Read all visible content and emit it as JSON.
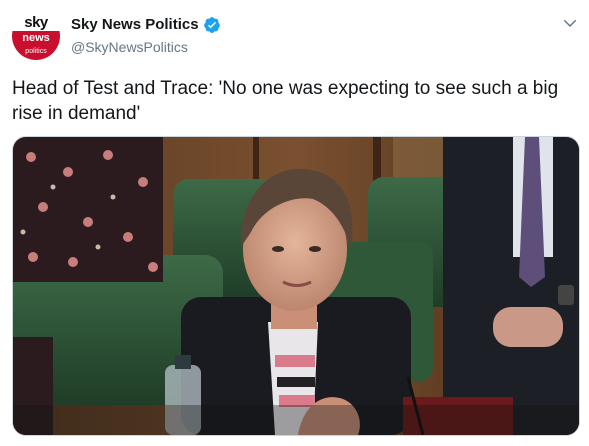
{
  "account": {
    "display_name": "Sky News Politics",
    "handle": "@SkyNewsPolitics",
    "verified": true,
    "avatar": {
      "line1": "sky",
      "line2": "news",
      "line3": "politics",
      "brand_color": "#c8102e"
    }
  },
  "tweet": {
    "text": "Head of Test and Trace: 'No one was expecting to see such a big rise in demand'"
  },
  "icons": {
    "verified": "verified-badge-icon",
    "menu": "chevron-down-icon"
  },
  "colors": {
    "accent": "#1da1f2",
    "secondary_text": "#657786",
    "primary_text": "#14171a"
  }
}
